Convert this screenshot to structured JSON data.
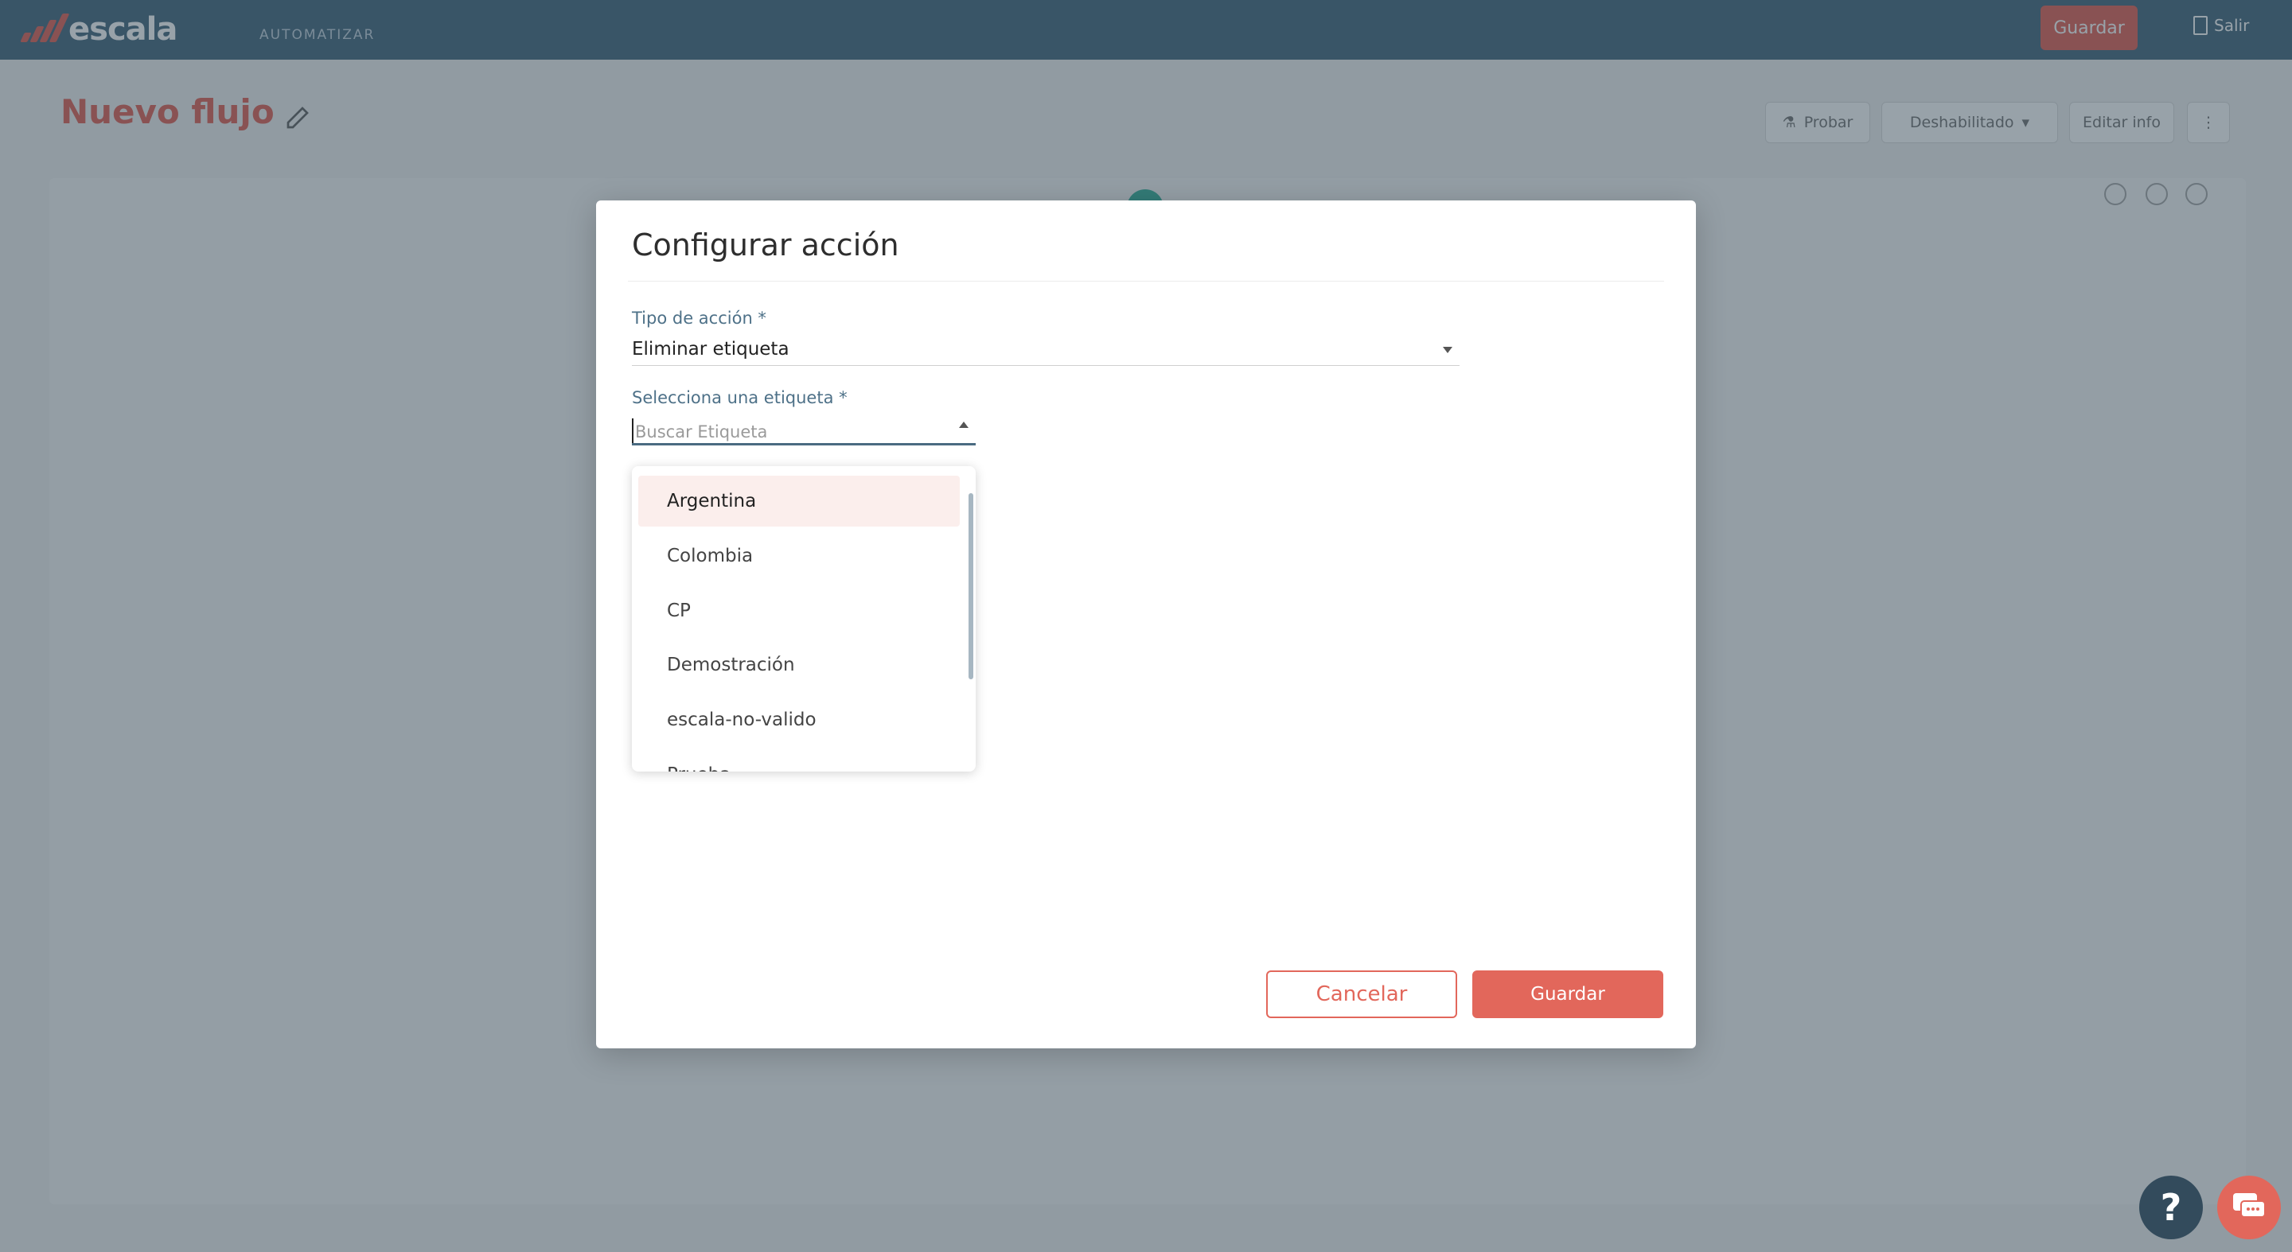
{
  "app": {
    "logo_text": "escala",
    "section": "AUTOMATIZAR",
    "header_save_label": "Guardar",
    "exit_label": "Salir"
  },
  "page": {
    "title": "Nuevo flujo",
    "toolbar": {
      "test_label": "Probar",
      "status_label": "Deshabilitado",
      "edit_info_label": "Editar info"
    }
  },
  "modal": {
    "title": "Configurar acción",
    "action_type": {
      "label": "Tipo de acción *",
      "value": "Eliminar etiqueta"
    },
    "tag_select": {
      "label": "Selecciona una etiqueta *",
      "placeholder": "Buscar Etiqueta",
      "options": [
        "Argentina",
        "Colombia",
        "CP",
        "Demostración",
        "escala-no-valido",
        "Prueba"
      ],
      "highlighted_index": 0
    },
    "cancel_label": "Cancelar",
    "save_label": "Guardar"
  },
  "floating": {
    "help_label": "?"
  },
  "colors": {
    "brand": "#e2675b",
    "topbar": "#4a6b81",
    "help_button": "#334b5c"
  }
}
